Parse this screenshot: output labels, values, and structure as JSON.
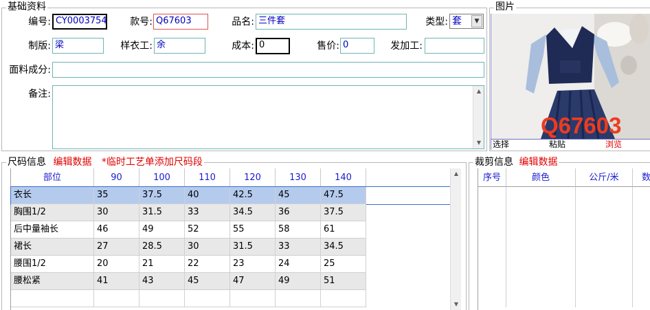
{
  "basic": {
    "title": "基础资料",
    "labels": {
      "code": "编号:",
      "style_no": "款号:",
      "product_name": "品名:",
      "type": "类型:",
      "pattern_maker": "制版:",
      "sample_worker": "样衣工:",
      "cost": "成本:",
      "price": "售价:",
      "processor": "发加工:",
      "fabric": "面料成分:",
      "remark": "备注:"
    },
    "values": {
      "code": "CY0003754",
      "style_no": "Q67603",
      "product_name": "三件套",
      "type": "套",
      "pattern_maker": "梁",
      "sample_worker": "余",
      "cost": "0",
      "price": "0",
      "processor": "",
      "fabric": "",
      "remark": ""
    }
  },
  "picture": {
    "title": "图片",
    "overlay_text": "Q67603",
    "actions": [
      "选择",
      "粘贴",
      "浏览"
    ]
  },
  "size_info": {
    "title": "尺码信息",
    "edit_link": "编辑数据",
    "note": "*临时工艺单添加尺码段",
    "columns": [
      "部位",
      "90",
      "100",
      "110",
      "120",
      "130",
      "140"
    ],
    "rows": [
      [
        "衣长",
        "35",
        "37.5",
        "40",
        "42.5",
        "45",
        "47.5"
      ],
      [
        "胸围1/2",
        "30",
        "31.5",
        "33",
        "34.5",
        "36",
        "37.5"
      ],
      [
        "后中量袖长",
        "46",
        "49",
        "52",
        "55",
        "58",
        "61"
      ],
      [
        "裙长",
        "27",
        "28.5",
        "30",
        "31.5",
        "33",
        "34.5"
      ],
      [
        "腰围1/2",
        "20",
        "21",
        "22",
        "23",
        "24",
        "25"
      ],
      [
        "腰松紧",
        "41",
        "43",
        "45",
        "47",
        "49",
        "51"
      ]
    ]
  },
  "cut_info": {
    "title": "裁剪信息",
    "edit_link": "编辑数据",
    "columns": [
      "序号",
      "颜色",
      "公斤/米",
      "数"
    ]
  },
  "icons": {
    "scroll_up": "arrow-up-icon",
    "scroll_down": "arrow-down-icon",
    "dropdown": "chevron-down-icon"
  }
}
